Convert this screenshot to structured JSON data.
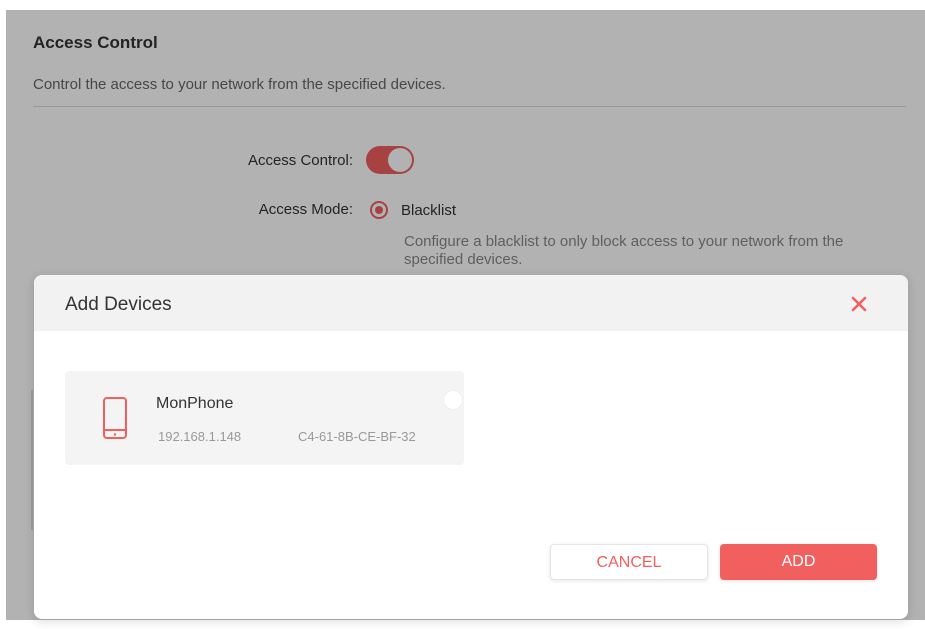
{
  "section": {
    "title": "Access Control",
    "description": "Control the access to your network from the specified devices."
  },
  "settings": {
    "access_control_label": "Access Control:",
    "access_control_enabled": true,
    "access_mode_label": "Access Mode:",
    "mode_option": "Blacklist",
    "mode_selected": true,
    "mode_hint": "Configure a blacklist to only block access to your network from the specified devices."
  },
  "modal": {
    "title": "Add Devices",
    "close_icon": "close-icon",
    "devices": [
      {
        "icon": "phone-icon",
        "name": "MonPhone",
        "ip": "192.168.1.148",
        "mac": "C4-61-8B-CE-BF-32",
        "selected": false
      }
    ],
    "cancel_label": "CANCEL",
    "add_label": "ADD"
  },
  "colors": {
    "accent": "#f15f5f",
    "overlay": "rgba(0,0,0,0.30)",
    "header_bg": "#f2f2f2",
    "card_bg": "#f4f4f4"
  }
}
